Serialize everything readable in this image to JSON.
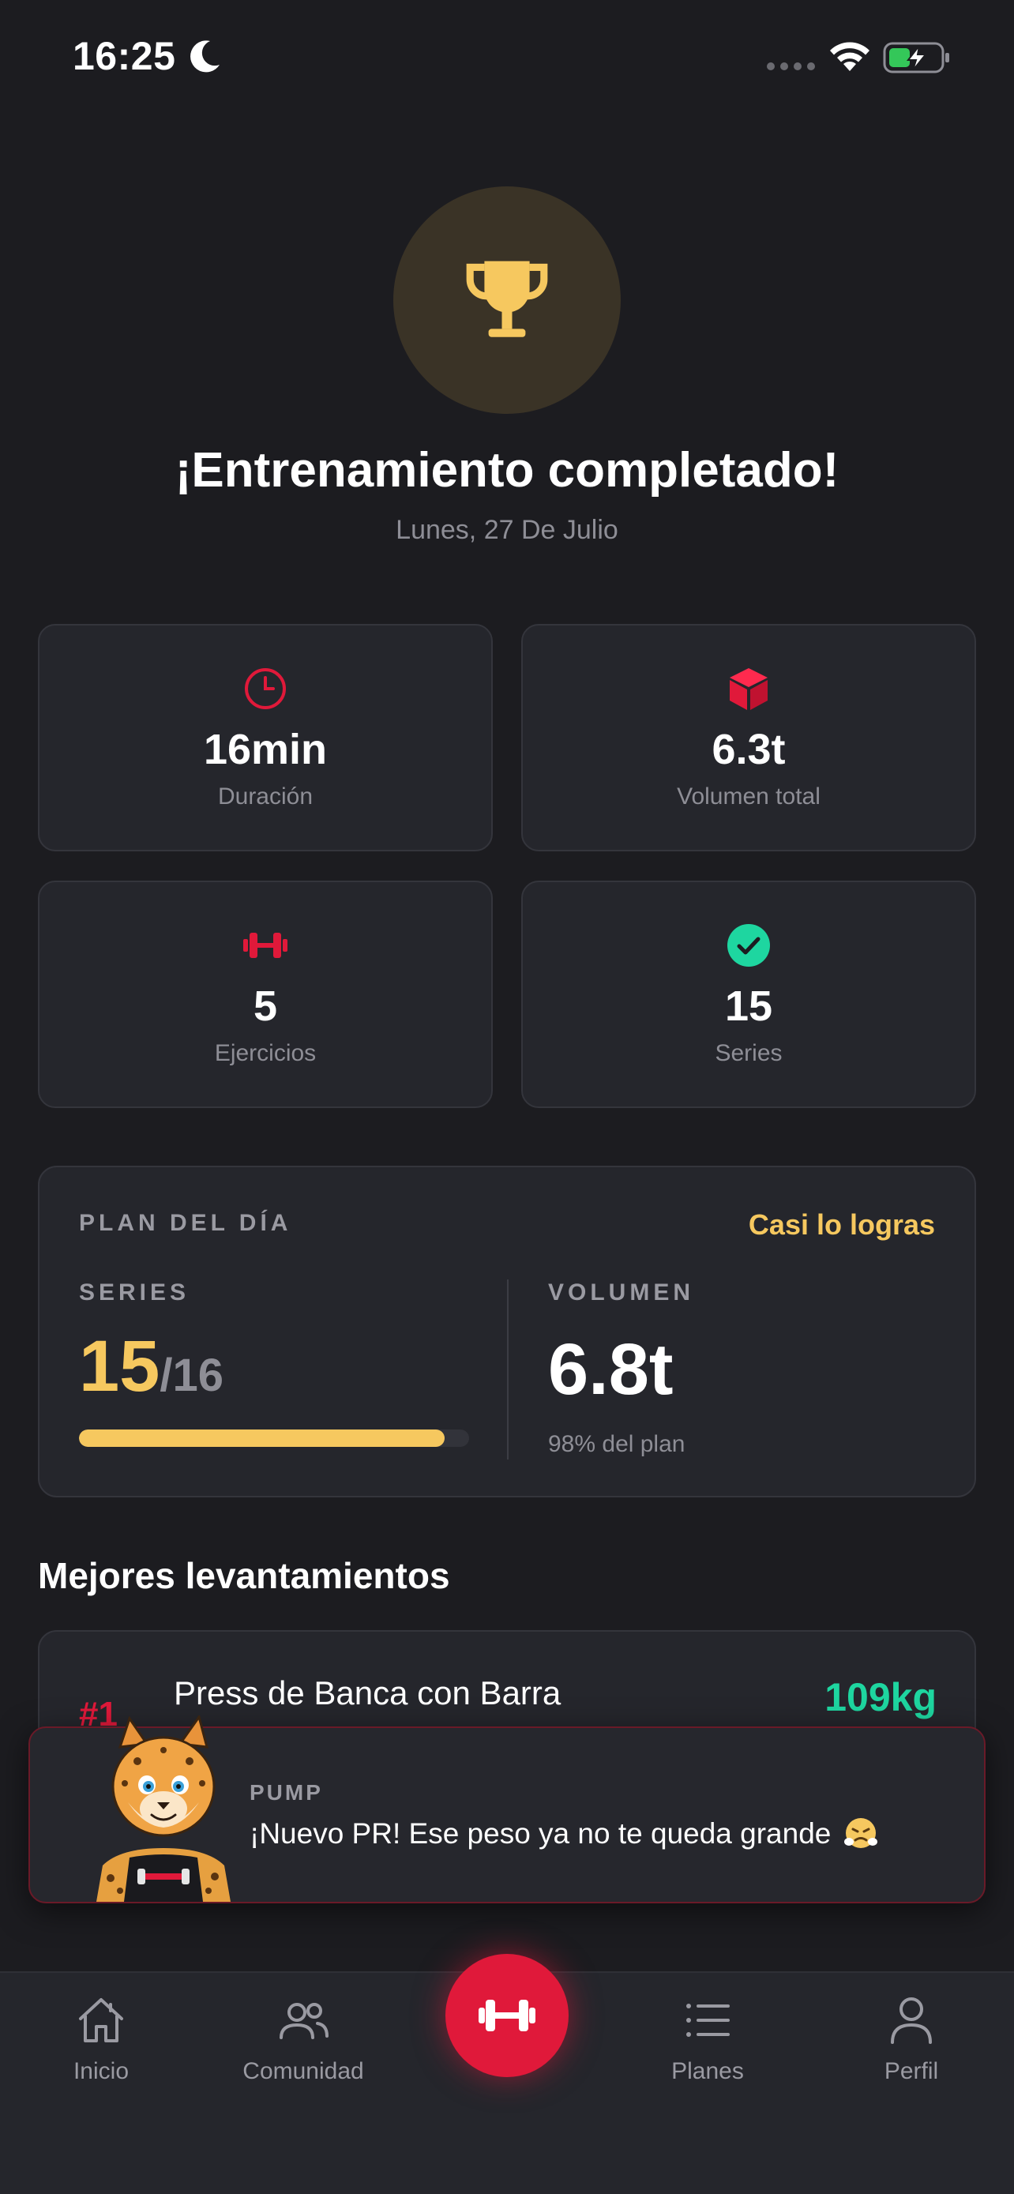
{
  "status_bar": {
    "time": "16:25"
  },
  "header": {
    "title": "¡Entrenamiento completado!",
    "date": "Lunes, 27 De Julio"
  },
  "stats": [
    {
      "icon": "clock-icon",
      "value": "16min",
      "label": "Duración"
    },
    {
      "icon": "cube-icon",
      "value": "6.3t",
      "label": "Volumen total"
    },
    {
      "icon": "dumbbell-icon",
      "value": "5",
      "label": "Ejercicios"
    },
    {
      "icon": "check-circle-icon",
      "value": "15",
      "label": "Series"
    }
  ],
  "plan": {
    "title": "PLAN DEL DÍA",
    "status": "Casi lo logras",
    "series_label": "SERIES",
    "series_done": "15",
    "series_total": "/16",
    "series_progress_fraction": 0.9375,
    "volume_label": "VOLUMEN",
    "volume_value": "6.8t",
    "volume_note": "98% del plan"
  },
  "best_lifts": {
    "title": "Mejores levantamientos",
    "items": [
      {
        "rank": "#1",
        "name": "Press de Banca con Barra",
        "weight": "109kg"
      }
    ]
  },
  "toast": {
    "sender": "PUMP",
    "message": "¡Nuevo PR! Ese peso ya no te queda grande"
  },
  "nav": {
    "home": "Inicio",
    "community": "Comunidad",
    "plans": "Planes",
    "profile": "Perfil"
  },
  "colors": {
    "background": "#1c1c20",
    "card": "#25262c",
    "accent_red": "#e0193a",
    "accent_yellow": "#f6c85f",
    "accent_green": "#1ed6a0",
    "muted_text": "#8e8e96"
  }
}
